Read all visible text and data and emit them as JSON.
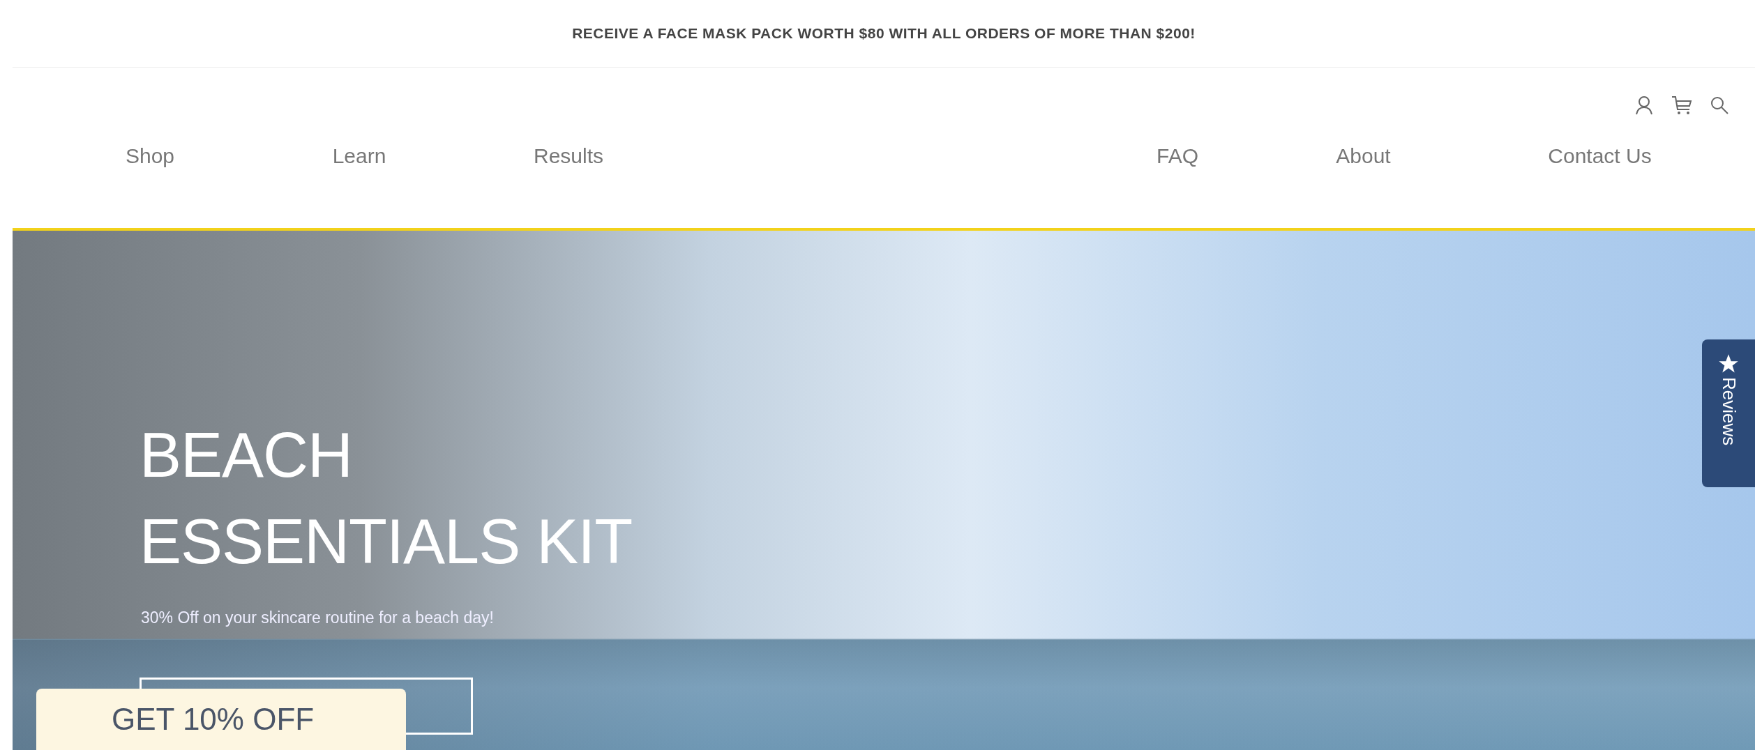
{
  "announcement": "RECEIVE A FACE MASK PACK WORTH $80 WITH ALL ORDERS OF MORE THAN $200!",
  "nav": {
    "left": [
      "Shop",
      "Learn",
      "Results"
    ],
    "right": [
      "FAQ",
      "About",
      "Contact Us"
    ]
  },
  "hero": {
    "title_lines": [
      "BEACH",
      "ESSENTIALS KIT"
    ],
    "subtitle": "30% Off on your skincare routine for a beach day!"
  },
  "discount_tab": {
    "label": "GET 10% OFF"
  },
  "reviews_tab": {
    "label": "Reviews"
  }
}
